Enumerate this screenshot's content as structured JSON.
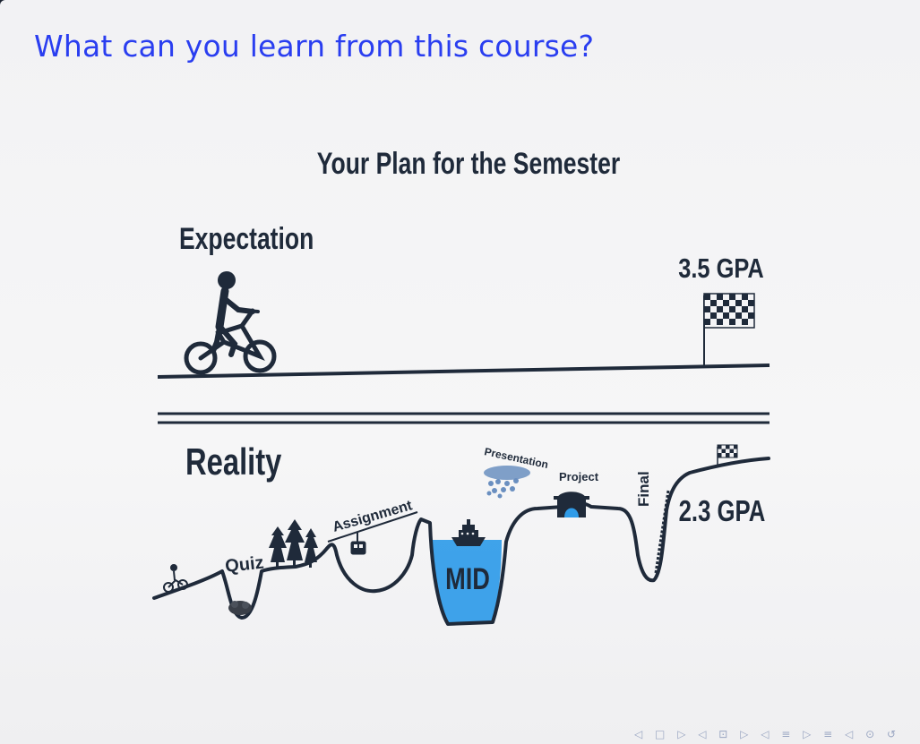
{
  "slide": {
    "title": "What can you learn from this course?"
  },
  "figure": {
    "heading": "Your Plan for the Semester",
    "expectation": {
      "label": "Expectation",
      "goal": "3.5 GPA"
    },
    "reality": {
      "label": "Reality",
      "result": "2.3 GPA",
      "milestones": {
        "quiz": "Quiz",
        "assignment": "Assignment",
        "mid": "MID",
        "presentation": "Presentation",
        "project": "Project",
        "final": "Final"
      }
    },
    "colors": {
      "ink": "#1f2a3a",
      "water": "#2f9be8",
      "rain": "#6a8fc0"
    }
  },
  "nav": {
    "glyphs": "◁ □ ▷ ◁ ⊡ ▷ ◁ ≡ ▷ ≡ ◁ ⊙ ↺"
  }
}
